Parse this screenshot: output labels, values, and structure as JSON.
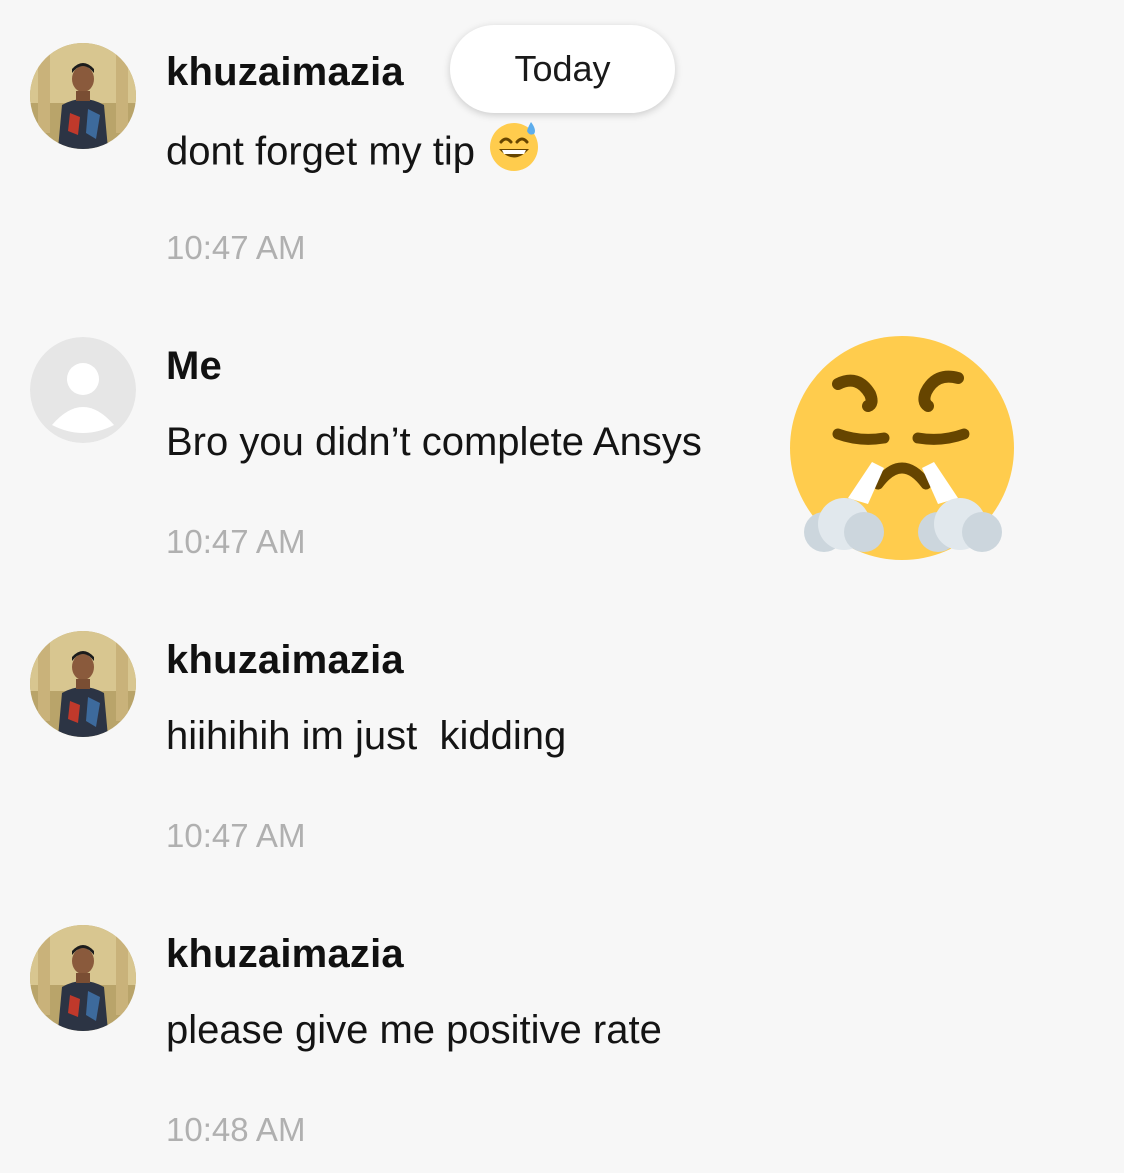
{
  "divider": {
    "today_label": "Today"
  },
  "messages": [
    {
      "sender": "khuzaimazia",
      "text": "dont forget my tip",
      "emoji": "sweat-smile",
      "time": "10:47 AM"
    },
    {
      "sender": "Me",
      "text": "Bro you didn’t complete Ansys",
      "emoji": "face-with-steam-from-nose",
      "time": "10:47 AM"
    },
    {
      "sender": "khuzaimazia",
      "text": "hiihihih im just  kidding",
      "time": "10:47 AM"
    },
    {
      "sender": "khuzaimazia",
      "text": "please give me positive rate",
      "time": "10:48 AM"
    }
  ],
  "colors": {
    "background": "#f7f7f7",
    "timestamp": "#b0b0b0",
    "emoji_yellow": "#ffcc4d"
  }
}
